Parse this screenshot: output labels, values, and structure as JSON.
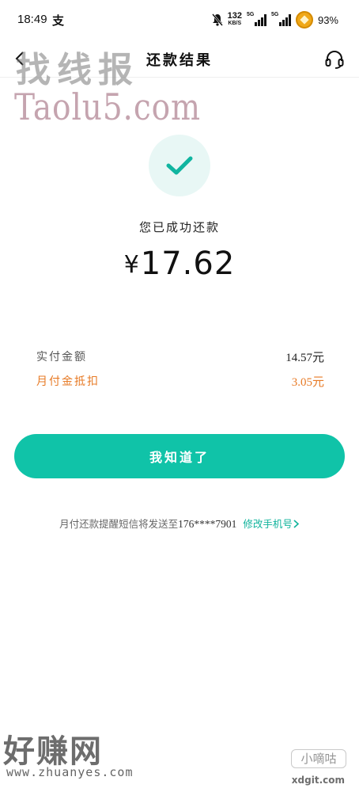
{
  "status_bar": {
    "time": "18:49",
    "alipay_glyph": "支",
    "net_speed_value": "132",
    "net_speed_unit": "KB/S",
    "sim1_tag": "5G",
    "sim2_tag": "5G",
    "battery": "93%",
    "icons": [
      "mute-bell-icon",
      "signal-icon",
      "signal-icon",
      "coin-icon"
    ]
  },
  "nav": {
    "title": "还款结果",
    "back_icon": "chevron-left-icon",
    "support_icon": "headset-icon"
  },
  "result": {
    "icon": "check-icon",
    "message": "您已成功还款",
    "currency": "¥",
    "amount": "17.62"
  },
  "details": [
    {
      "label": "实付金额",
      "value": "14.57元"
    },
    {
      "label": "月付金抵扣",
      "value": "3.05元"
    }
  ],
  "button": {
    "label": "我知道了"
  },
  "notice": {
    "text": "月付还款提醒短信将发送至",
    "phone": "176****7901",
    "modify_link": "修改手机号"
  },
  "watermarks": {
    "top_cn": "找线报",
    "top_en": "Taolu5.com",
    "bottom_cn": "好赚网",
    "bottom_url": "www.zhuanyes.com",
    "badge": "小嘀咕",
    "badge_url": "xdgit.com"
  },
  "colors": {
    "accent": "#10c3a8",
    "check_bg": "#e8f7f5",
    "deduction": "#e77a25",
    "link": "#10b39c"
  }
}
